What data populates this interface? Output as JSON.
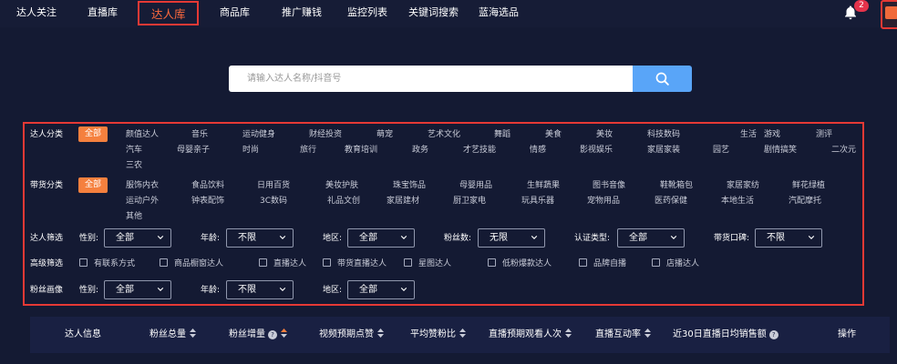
{
  "nav": {
    "items": [
      {
        "label": "达人关注"
      },
      {
        "label": "直播库"
      },
      {
        "label": "达人库"
      },
      {
        "label": "商品库"
      },
      {
        "label": "推广赚钱"
      },
      {
        "label": "监控列表"
      },
      {
        "label": "关键词搜索"
      },
      {
        "label": "蓝海选品"
      }
    ],
    "active_index": 2,
    "notification_count": "2",
    "bell_icon": "bell-icon",
    "gift_icon": "gift-icon"
  },
  "search": {
    "placeholder": "请输入达人名称/抖音号",
    "value": "",
    "button_icon": "search-icon"
  },
  "filters": {
    "category": {
      "label": "达人分类",
      "selected": "全部",
      "row1": [
        "颜值达人",
        "音乐",
        "运动健身",
        "财经投资",
        "萌宠",
        "艺术文化",
        "舞蹈",
        "美食",
        "美妆",
        "科技数码",
        "生活",
        "游戏",
        "测评"
      ],
      "row2": [
        "汽车",
        "母婴亲子",
        "时尚",
        "旅行",
        "教育培训",
        "政务",
        "才艺技能",
        "情感",
        "影视娱乐",
        "家居家装",
        "园艺",
        "剧情搞笑",
        "二次元"
      ],
      "row3": [
        "三农"
      ]
    },
    "goods": {
      "label": "带货分类",
      "selected": "全部",
      "row1": [
        "服饰内衣",
        "食品饮料",
        "日用百货",
        "美妆护肤",
        "珠宝饰品",
        "母婴用品",
        "生鲜蔬果",
        "图书音像",
        "鞋靴箱包",
        "家居家纺",
        "鲜花绿植"
      ],
      "row2": [
        "运动户外",
        "钟表配饰",
        "3C数码",
        "礼品文创",
        "家居建材",
        "厨卫家电",
        "玩具乐器",
        "宠物用品",
        "医药保健",
        "本地生活",
        "汽配摩托"
      ],
      "row3": [
        "其他"
      ]
    },
    "screening": {
      "label": "达人筛选",
      "fields": [
        {
          "label": "性别:",
          "value": "全部"
        },
        {
          "label": "年龄:",
          "value": "不限"
        },
        {
          "label": "地区:",
          "value": "全部"
        },
        {
          "label": "粉丝数:",
          "value": "无限"
        },
        {
          "label": "认证类型:",
          "value": "全部"
        },
        {
          "label": "带货口碑:",
          "value": "不限"
        }
      ]
    },
    "advanced": {
      "label": "高级筛选",
      "options": [
        "有联系方式",
        "商品橱窗达人",
        "直播达人",
        "带货直播达人",
        "星图达人",
        "低粉爆款达人",
        "品牌自播",
        "店播达人"
      ]
    },
    "fans_profile": {
      "label": "粉丝画像",
      "fields": [
        {
          "label": "性别:",
          "value": "全部"
        },
        {
          "label": "年龄:",
          "value": "不限"
        },
        {
          "label": "地区:",
          "value": "全部"
        }
      ]
    }
  },
  "table": {
    "columns": [
      {
        "label": "达人信息",
        "sortable": false,
        "help": false
      },
      {
        "label": "粉丝总量",
        "sortable": true,
        "help": false
      },
      {
        "label": "粉丝增量",
        "sortable": true,
        "help": true
      },
      {
        "label": "视频预期点赞",
        "sortable": true,
        "help": false
      },
      {
        "label": "平均赞粉比",
        "sortable": true,
        "help": false
      },
      {
        "label": "直播预期观看人次",
        "sortable": true,
        "help": false
      },
      {
        "label": "直播互动率",
        "sortable": true,
        "help": false
      },
      {
        "label": "近30日直播日均销售额",
        "sortable": false,
        "help": true
      },
      {
        "label": "操作",
        "sortable": false,
        "help": false
      }
    ],
    "help_glyph": "?"
  },
  "colors": {
    "background": "#141a33",
    "accent_orange": "#f5803e",
    "highlight_red": "#e53935",
    "search_blue": "#59a5f8"
  }
}
